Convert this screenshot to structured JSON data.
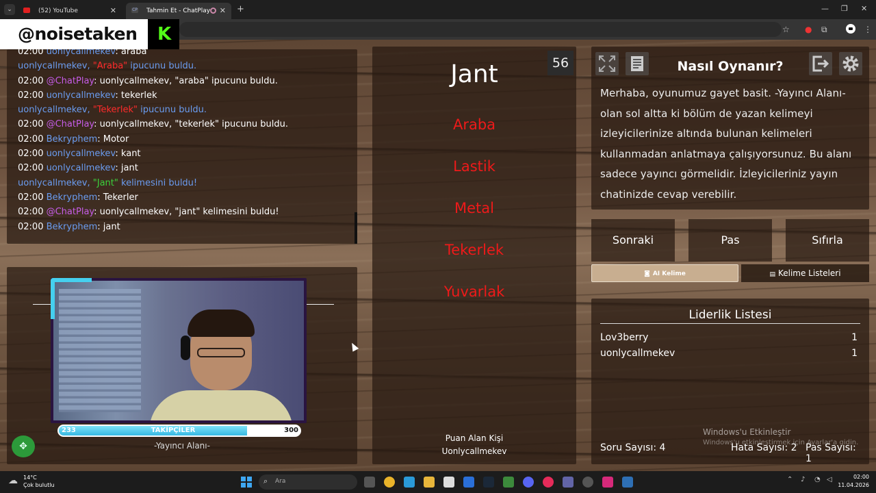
{
  "browser": {
    "tabs": [
      {
        "label": "(52) YouTube",
        "close": "✕"
      },
      {
        "label": "Tahmin Et - ChatPlay",
        "close": "✕",
        "favicon": "CP"
      }
    ],
    "new_tab": "+",
    "tab_menu": "⌄",
    "window_controls": {
      "minimize": "—",
      "maximize": "❐",
      "close": "✕"
    }
  },
  "overlay": {
    "handle": "@noisetaken",
    "logo": "K"
  },
  "chat": {
    "lines": [
      {
        "time": "02:00",
        "user": "uonlycallmekev",
        "sep": ": ",
        "msg": "araba"
      },
      {
        "pre": "uonlycallmekev, ",
        "word": "\"Araba\"",
        "post": " ipucunu buldu."
      },
      {
        "time": "02:00",
        "user": "@ChatPlay",
        "sep": ": ",
        "msg": "uonlycallmekev, \"araba\" ipucunu buldu."
      },
      {
        "time": "02:00",
        "user": "uonlycallmekev",
        "sep": ": ",
        "msg": "tekerlek"
      },
      {
        "pre": "uonlycallmekev, ",
        "word": "\"Tekerlek\"",
        "post": " ipucunu buldu."
      },
      {
        "time": "02:00",
        "user": "@ChatPlay",
        "sep": ": ",
        "msg": "uonlycallmekev, \"tekerlek\" ipucunu buldu."
      },
      {
        "time": "02:00",
        "user": "Bekryphem",
        "sep": ": ",
        "msg": "Motor"
      },
      {
        "time": "02:00",
        "user": "uonlycallmekev",
        "sep": ": ",
        "msg": "kant"
      },
      {
        "time": "02:00",
        "user": "uonlycallmekev",
        "sep": ": ",
        "msg": "jant"
      },
      {
        "pre": "uonlycallmekev, ",
        "word": "\"Jant\"",
        "post": " kelimesini buldu!"
      },
      {
        "time": "02:00",
        "user": "Bekryphem",
        "sep": ": ",
        "msg": "Tekerler"
      },
      {
        "time": "02:00",
        "user": "@ChatPlay",
        "sep": ": ",
        "msg": "uonlycallmekev, \"jant\" kelimesini buldu!"
      },
      {
        "time": "02:00",
        "user": "Bekryphem",
        "sep": ": ",
        "msg": "jant"
      }
    ]
  },
  "camera": {
    "followers_label": "TAKİPÇİLER",
    "followers_current": "233",
    "followers_goal": "300",
    "followers_progress": 0.78,
    "area_label": "-Yayıncı Alanı-"
  },
  "game": {
    "timer": "56",
    "word": "Jant",
    "banned": [
      "Araba",
      "Lastik",
      "Metal",
      "Tekerlek",
      "Yuvarlak"
    ],
    "scorer_title": "Puan Alan Kişi",
    "scorer_name": "Uonlycallmekev"
  },
  "info": {
    "title": "Nasıl Oynanır?",
    "text": "Merhaba, oyunumuz gayet basit. -Yayıncı Alanı- olan sol altta ki bölüm de yazan kelimeyi izleyicilerinize altında bulunan kelimeleri kullanmadan anlatmaya çalışıyorsunuz. Bu alanı sadece yayıncı görmelidir. İzleyicileriniz yayın chatinizde cevap verebilir."
  },
  "controls": {
    "next": "Sonraki",
    "pass": "Pas",
    "reset": "Sıfırla",
    "ai_word": "AI Kelime",
    "word_lists": "Kelime Listeleri"
  },
  "leaderboard": {
    "title": "Liderlik Listesi",
    "rows": [
      {
        "name": "Lov3berry",
        "score": "1"
      },
      {
        "name": "uonlycallmekev",
        "score": "1"
      }
    ],
    "questions": "Soru Sayısı: 4",
    "errors": "Hata Sayısı: 2",
    "passes": "Pas Sayısı: 1"
  },
  "watermark": {
    "title": "Windows'u Etkinleştir",
    "subtitle": "Windows'u etkinleştirmek için Ayarlar'a gidin."
  },
  "taskbar": {
    "temp": "14°C",
    "weather": "Çok bulutlu",
    "search_placeholder": "Ara",
    "time": "02:00",
    "date": "11.04.2026"
  },
  "colors": {
    "user": "#6a9cf0",
    "chatplay": "#c65ce8",
    "banned": "#ee1a1a",
    "kick": "#53fc18",
    "followers_bar": "#37b8e2"
  }
}
